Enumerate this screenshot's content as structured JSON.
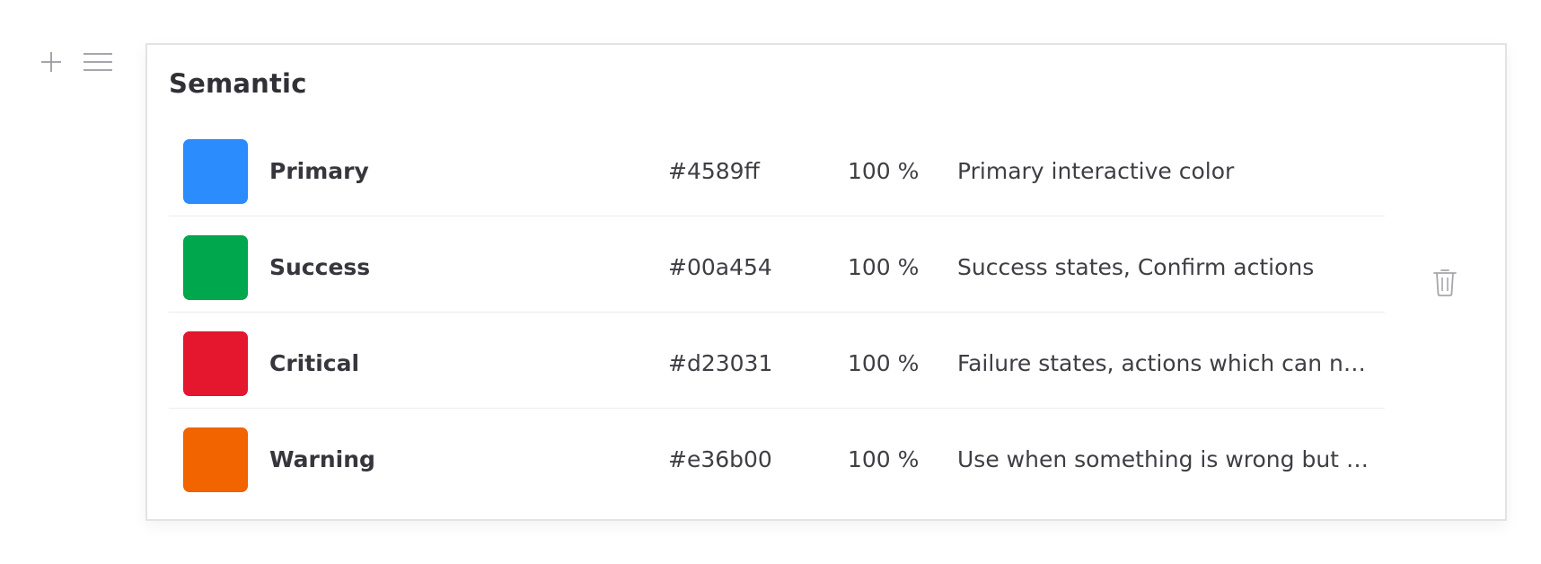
{
  "block_controls": {
    "add_icon": "plus-icon",
    "drag_icon": "drag-handle-icon"
  },
  "palette": {
    "title": "Semantic",
    "delete_icon": "trash-icon",
    "colors": [
      {
        "name": "Primary",
        "hex": "#4589ff",
        "swatch": "#2b8cfe",
        "opacity": "100 %",
        "description": "Primary interactive color"
      },
      {
        "name": "Success",
        "hex": "#00a454",
        "swatch": "#00a74d",
        "opacity": "100 %",
        "description": "Success states, Confirm actions"
      },
      {
        "name": "Critical",
        "hex": "#d23031",
        "swatch": "#e4172f",
        "opacity": "100 %",
        "description": "Failure states, actions which can not …"
      },
      {
        "name": "Warning",
        "hex": "#e36b00",
        "swatch": "#f26400",
        "opacity": "100 %",
        "description": "Use when something is wrong but no…"
      }
    ]
  }
}
